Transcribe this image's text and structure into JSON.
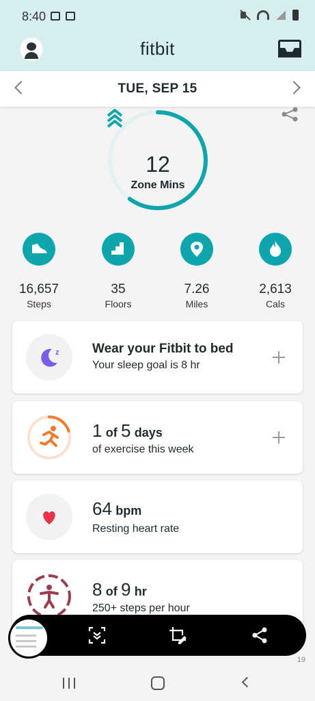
{
  "status_bar": {
    "time": "8:40"
  },
  "header": {
    "brand": "fitbit"
  },
  "date_nav": {
    "date": "TUE, SEP 15"
  },
  "zone": {
    "value": "12",
    "label": "Zone Mins",
    "progress_fraction": 0.6
  },
  "stats": [
    {
      "value": "16,657",
      "label": "Steps",
      "icon": "shoe-icon"
    },
    {
      "value": "35",
      "label": "Floors",
      "icon": "stairs-icon"
    },
    {
      "value": "7.26",
      "label": "Miles",
      "icon": "location-pin-icon"
    },
    {
      "value": "2,613",
      "label": "Cals",
      "icon": "flame-icon"
    }
  ],
  "cards": {
    "sleep": {
      "title": "Wear your Fitbit to bed",
      "subtitle": "Your sleep goal is 8 hr"
    },
    "exercise": {
      "value": "1",
      "of": "of",
      "total": "5",
      "unit": "days",
      "subtitle": "of exercise this week",
      "fraction": 0.2
    },
    "heart": {
      "value": "64",
      "unit": "bpm",
      "subtitle": "Resting heart rate"
    },
    "hourly": {
      "value": "8",
      "of": "of",
      "total": "9",
      "unit": "hr",
      "subtitle": "250+ steps per hour"
    }
  },
  "colors": {
    "accent": "#0ea5ad",
    "header_bg": "#d7eef0",
    "sleep": "#7b5ce6",
    "exercise": "#f07b2f",
    "heart": "#e8344a",
    "hourly": "#9b3d4f"
  },
  "toolbar": {
    "icons": [
      "scroll-capture-icon",
      "crop-edit-icon",
      "share-icon"
    ]
  },
  "partial_text": {
    "right_number": "19"
  }
}
